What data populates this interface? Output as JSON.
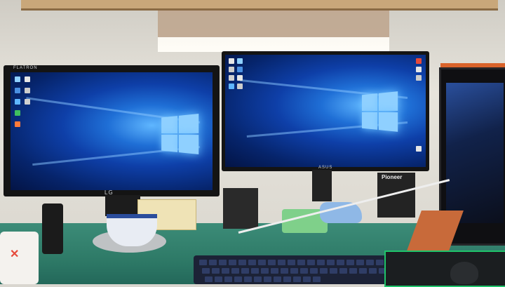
{
  "scene": {
    "description_elements": [
      "wall",
      "desk",
      "left-monitor",
      "right-monitor",
      "pc-case",
      "keyboard",
      "mousepad",
      "mouse",
      "mug",
      "speaker",
      "pioneer-device"
    ]
  },
  "left_monitor": {
    "brand": "LG",
    "model_text": "FLATRON"
  },
  "right_monitor": {
    "brand": "ASUS"
  },
  "devices": {
    "pioneer_label": "Pioneer"
  },
  "colors": {
    "desk": "#2e7a67",
    "wallpaper_blue": "#0e3fa8",
    "wallpaper_light": "#8fd0ff",
    "mousepad_accent": "#1fc46a",
    "pc_accent": "#d9632b"
  }
}
